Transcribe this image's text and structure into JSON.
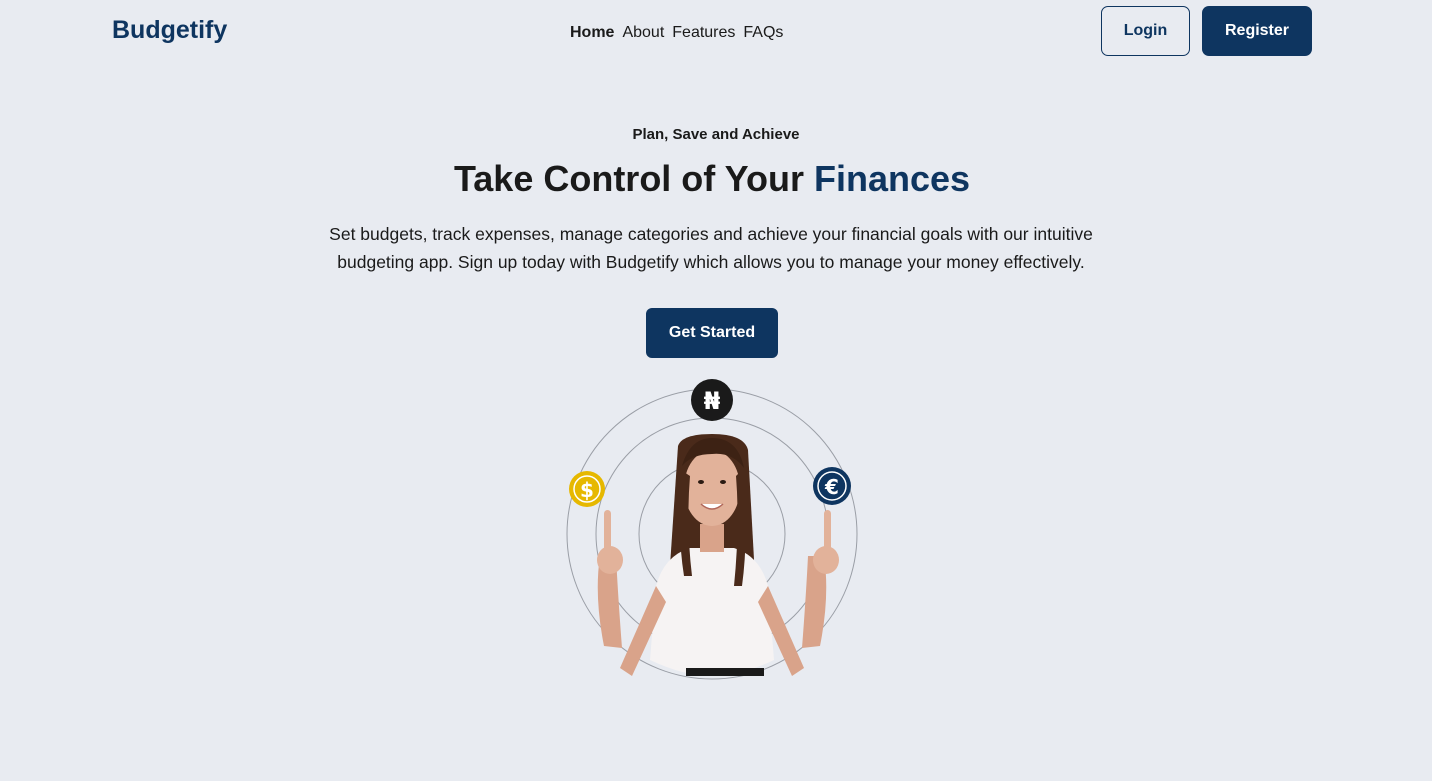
{
  "header": {
    "logo": "Budgetify",
    "nav": [
      {
        "label": "Home",
        "active": true
      },
      {
        "label": "About",
        "active": false
      },
      {
        "label": "Features",
        "active": false
      },
      {
        "label": "FAQs",
        "active": false
      }
    ],
    "login_label": "Login",
    "register_label": "Register"
  },
  "hero": {
    "eyebrow": "Plan, Save and Achieve",
    "headline_main": "Take Control of Your ",
    "headline_accent": "Finances",
    "subtext": "Set budgets, track expenses, manage categories and achieve your financial goals with our intuitive budgeting app. Sign up today with Budgetify which allows you to manage your money effectively.",
    "cta_label": "Get Started"
  },
  "illustration": {
    "currency_icons": [
      {
        "name": "naira-coin-icon",
        "symbol": "₦",
        "color": "#1a1a1a"
      },
      {
        "name": "dollar-coin-icon",
        "symbol": "$",
        "color": "#e6b800"
      },
      {
        "name": "euro-coin-icon",
        "symbol": "€",
        "color": "#0e3560"
      }
    ]
  },
  "colors": {
    "background": "#e8ebf1",
    "brand": "#0e3560",
    "text": "#1a1a1a"
  }
}
